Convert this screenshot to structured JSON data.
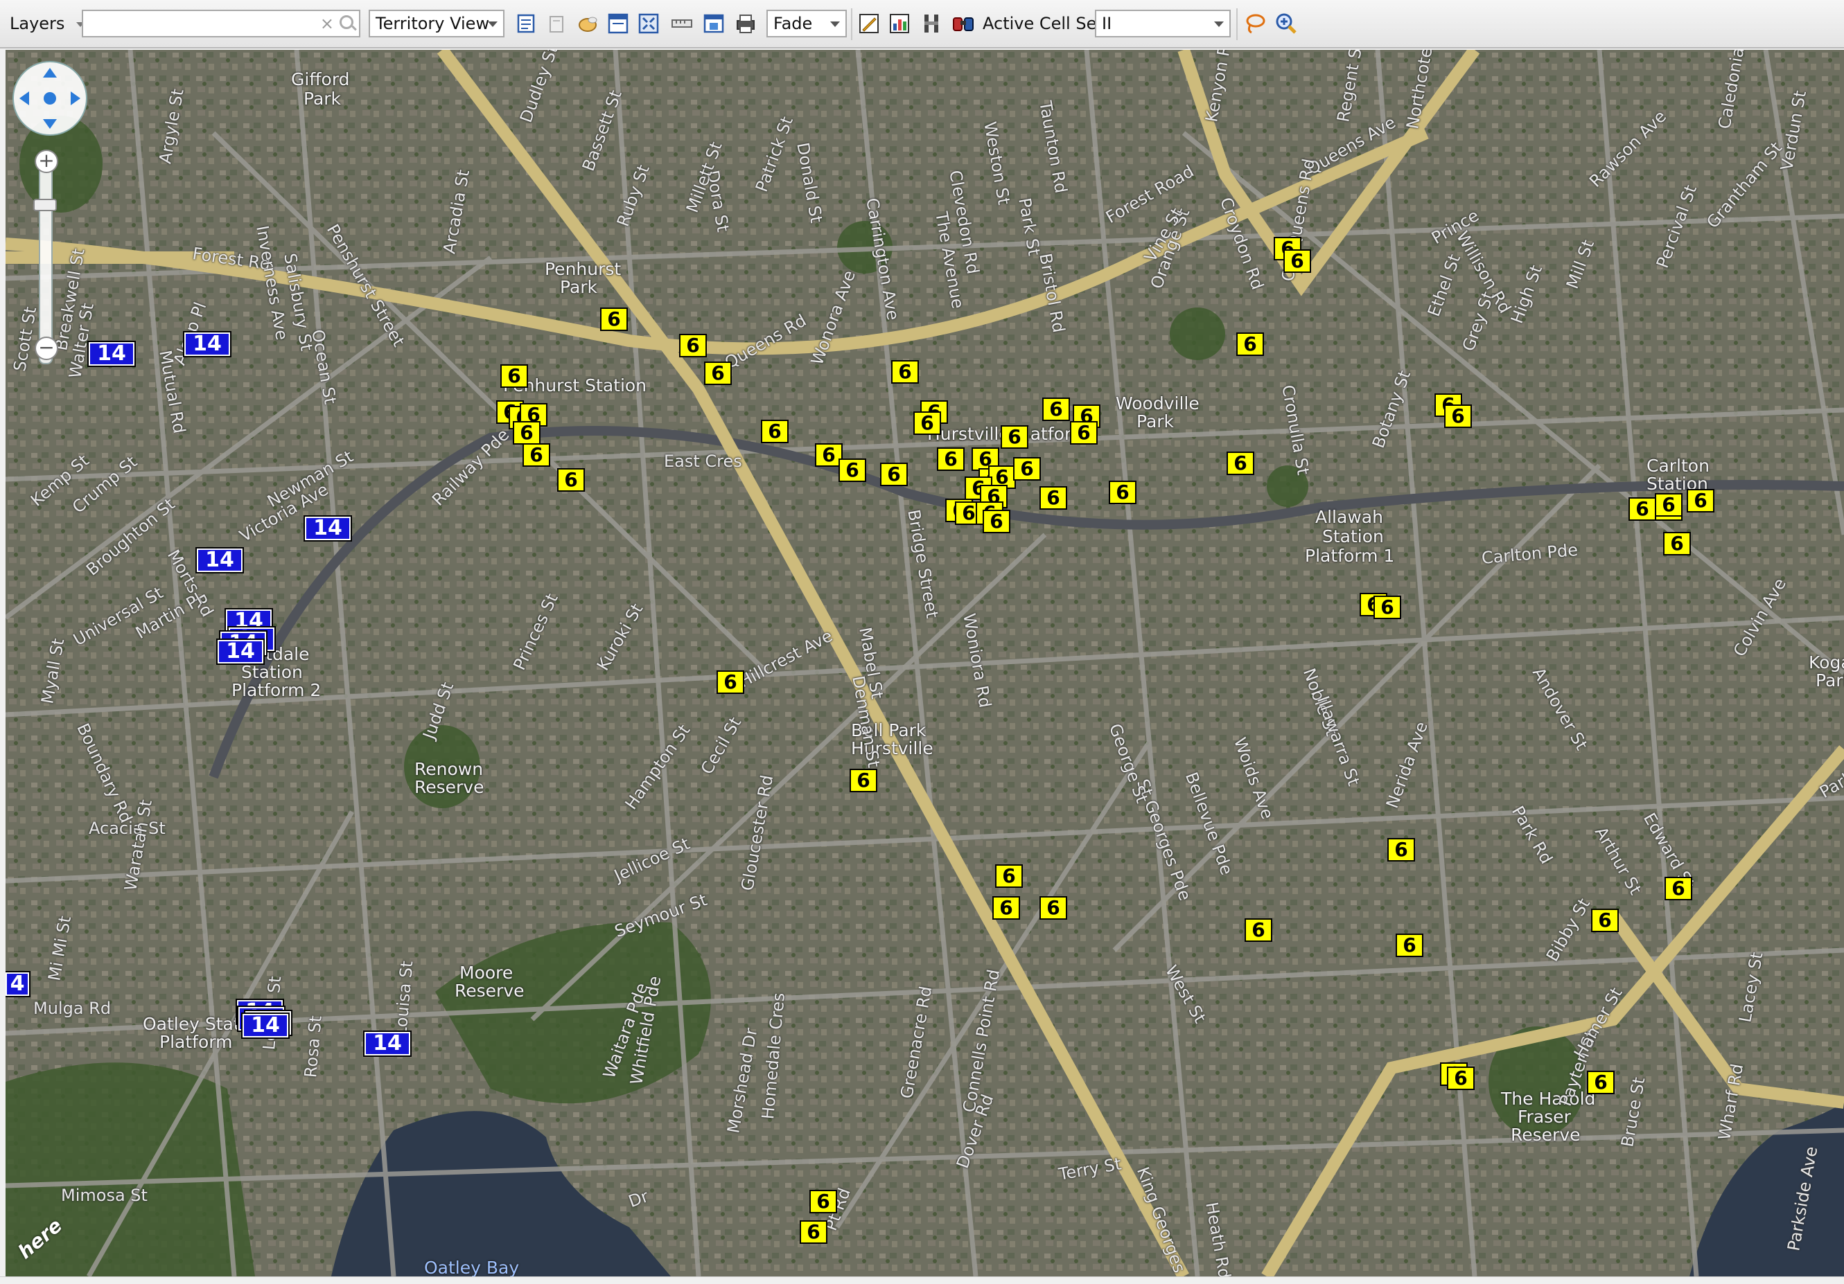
{
  "toolbar": {
    "layers_label": "Layers",
    "search_value": "",
    "territory_view": "Territory View",
    "fade_mode": "Fade",
    "active_cell_set_label": "Active Cell Set",
    "active_cell_set_value": "II",
    "icons": [
      "edit-icon",
      "delete-icon",
      "pan-hand-icon",
      "properties-icon",
      "zoom-extent-icon",
      "ruler-icon",
      "export-icon",
      "print-icon",
      "edit-layer-icon",
      "chart-icon",
      "table-icon",
      "binoculars-icon",
      "lasso-select-icon",
      "zoom-in-icon"
    ]
  },
  "map": {
    "places": [
      {
        "name": "Penhurst Station Platform",
        "label": "Penhurst Station"
      },
      {
        "name": "Hurstville Station Platform",
        "label": "Hurstville Platform"
      },
      {
        "name": "Allawah Station",
        "label": "Allawah"
      },
      {
        "name": "Allawah Station Platform 1",
        "label": "Station"
      },
      {
        "name": "Platform 1",
        "label": "Platform 1"
      },
      {
        "name": "Carlton Station",
        "label": "Carlton"
      },
      {
        "name": "Carlton Station 2",
        "label": "Station"
      },
      {
        "name": "Mortdale Station",
        "label": "Mortdale"
      },
      {
        "name": "Mortdale Station Platform 2",
        "label": "Station"
      },
      {
        "name": "Platform 2",
        "label": "Platform 2"
      },
      {
        "name": "Oatley Station",
        "label": "Oatley Station"
      },
      {
        "name": "Oatley Platform",
        "label": "Platform"
      },
      {
        "name": "Gifford Park",
        "label": "Gifford"
      },
      {
        "name": "Gifford Park 2",
        "label": "Park"
      },
      {
        "name": "Penhurst Park",
        "label": "Penhurst"
      },
      {
        "name": "Penhurst Park 2",
        "label": "Park"
      },
      {
        "name": "Woodville Park",
        "label": "Woodville"
      },
      {
        "name": "Woodville Park 2",
        "label": "Park"
      },
      {
        "name": "Renown Reserve",
        "label": "Renown"
      },
      {
        "name": "Renown Reserve 2",
        "label": "Reserve"
      },
      {
        "name": "Moore Reserve",
        "label": "Moore"
      },
      {
        "name": "Moore Reserve 2",
        "label": "Reserve"
      },
      {
        "name": "Bell Park",
        "label": "Bell Park"
      },
      {
        "name": "Bell Park 2",
        "label": "Hurstville"
      },
      {
        "name": "Harold Fraser Reserve",
        "label": "The Harold"
      },
      {
        "name": "Harold Fraser Reserve 2",
        "label": "Fraser"
      },
      {
        "name": "Harold Fraser Reserve 3",
        "label": "Reserve"
      },
      {
        "name": "Oatley Bay",
        "label": "Oatley Bay"
      },
      {
        "name": "Kogarah Park",
        "label": "Kogar"
      },
      {
        "name": "Kogarah Park 2",
        "label": "Park"
      }
    ],
    "streets": [
      "Forest Rd",
      "Queens Rd",
      "Croydon Rd",
      "Carlton Pde",
      "Railway Pde",
      "Victoria Ave",
      "Hillcrest Ave",
      "Morts Rd",
      "Boundary Rd",
      "Mulga Rd",
      "Mimosa St",
      "Seymour St",
      "Jellicoe St",
      "Cecil St",
      "Hampton St",
      "Judd St",
      "Princes St",
      "Kuroki St",
      "Denman St",
      "Mabel St",
      "Woniora Rd",
      "King Georges Rd",
      "Terry St",
      "Heath Rd",
      "Park Rd",
      "Bibby St",
      "Dora St",
      "Donald St",
      "Clevedon Rd",
      "Weston St",
      "Taunton Rd",
      "Kenyon Rd",
      "Regent St",
      "Northcote St",
      "Caledonian St",
      "Verdun St",
      "Ethel St",
      "Grey St",
      "High St",
      "Mill St",
      "Willison Rd",
      "Rawson Ave",
      "Grantham St",
      "Percival St",
      "Colvin Ave",
      "Edward St",
      "Arthur St",
      "Andover St",
      "Noble St",
      "Woids Ave",
      "Bellevue Pde",
      "St Georges Pde",
      "George St",
      "West St",
      "Illawarra St",
      "Botany St",
      "Cronulla St",
      "Orange St",
      "Vine St",
      "Park St",
      "Bristol Rd",
      "The Avenue",
      "Carrington Ave",
      "Dudley St",
      "Bassett St",
      "Ruby St",
      "Millett St",
      "Patrick St",
      "Universal St",
      "Broughton St",
      "Crump St",
      "Kemp St",
      "Walter St",
      "Scott St",
      "Breakwell St",
      "Argyle St",
      "Penshurst Street",
      "Arcadia St",
      "Inverness Ave",
      "Salisbury St",
      "Ocean St",
      "Mutual Rd",
      "Alsop Pl",
      "Newman St",
      "Martin Pl",
      "Myall St",
      "Acacia St",
      "Waratah St",
      "Mi Mi St",
      "Louisa St",
      "Letitia St",
      "Rosa St",
      "Waitara Pde",
      "Whitfield Pde",
      "Morshead Dr",
      "Homedale Cres",
      "Greenacre Rd",
      "Connells Point Rd",
      "Dover Rd",
      "Pt Rd",
      "Dr",
      "Bruce St",
      "Payten St",
      "Hamer St",
      "Lacey St",
      "Wharf Rd",
      "Parkside Ave",
      "Nerida Ave",
      "Wonora Ave",
      "Bridge Street",
      "East Cres",
      "Gloucester Rd",
      "Queens Ave",
      "Old Queens Rd",
      "Forest Road",
      "Prince",
      "Park Road Rd"
    ],
    "markers_yellow": [
      "6",
      "6",
      "6",
      "6",
      "6",
      "6",
      "6",
      "6",
      "6",
      "6",
      "6",
      "6",
      "6",
      "6",
      "6",
      "6",
      "6",
      "6",
      "6",
      "6",
      "6",
      "6",
      "6",
      "6",
      "6",
      "6",
      "6",
      "6",
      "6",
      "6",
      "6",
      "6",
      "6",
      "6",
      "6",
      "6",
      "6",
      "6",
      "6",
      "6",
      "6",
      "6",
      "6",
      "6",
      "6",
      "6",
      "6",
      "6",
      "6",
      "6",
      "6",
      "6",
      "6",
      "6",
      "6",
      "6",
      "6",
      "6",
      "6",
      "6",
      "6",
      "6"
    ],
    "markers_blue": [
      "14",
      "14",
      "14",
      "14",
      "14",
      "14",
      "14",
      "14",
      "14",
      "14",
      "14",
      "14",
      "14",
      "4"
    ],
    "logo": "here",
    "zoom_plus": "+",
    "zoom_minus": "−"
  }
}
